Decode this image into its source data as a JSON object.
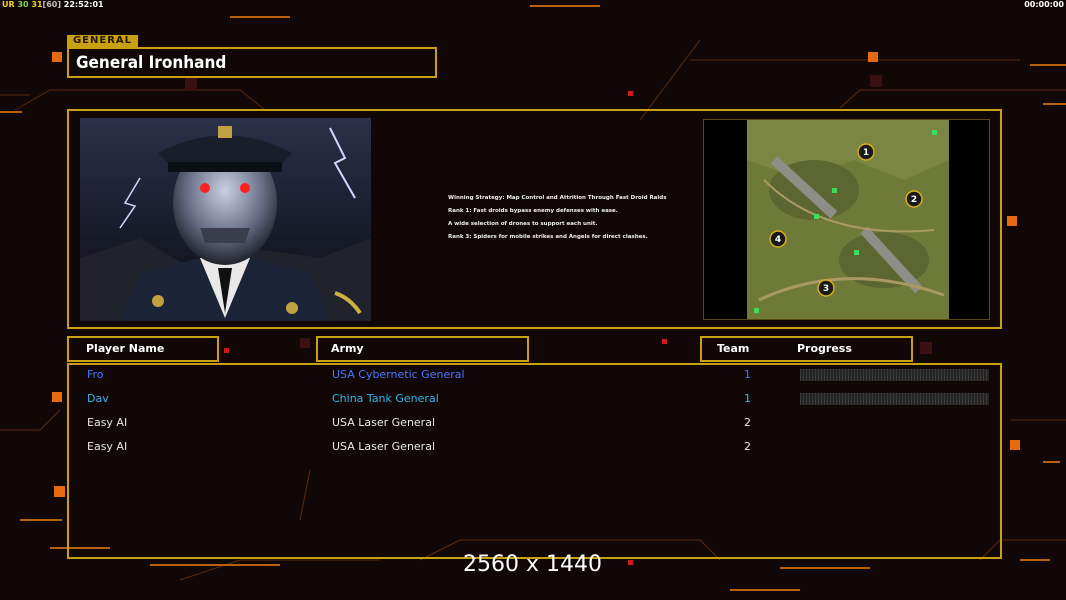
{
  "hud": {
    "ur_label": "UR",
    "fps": "30",
    "fps_alt": "31",
    "fps_cap": "[60]",
    "clock": "22:52:01",
    "timer": "00:00:00"
  },
  "colors": {
    "accent_gold": "#c9a012",
    "background": "#120707",
    "player_blue": "#4a76ff",
    "player_cyan": "#2fb6e6",
    "player_white": "#e8e8e8"
  },
  "general": {
    "tag": "GENERAL",
    "name": "General Ironhand",
    "portrait_icon": "cyborg-general-portrait",
    "map_icon": "skirmish-map-preview",
    "map_start_positions": [
      "1",
      "2",
      "3",
      "4"
    ]
  },
  "description": [
    "Winning Strategy: Map Control and Attrition Through Fast Droid Raids",
    "Rank 1: Fast droids bypass enemy defenses with ease.",
    "A wide selection of drones to support each unit.",
    "Rank 3: Spiders for mobile strikes and Angels for direct clashes."
  ],
  "columns": {
    "player_name": "Player Name",
    "army": "Army",
    "team": "Team",
    "progress": "Progress"
  },
  "players": [
    {
      "name": "Fro",
      "army": "USA Cybernetic General",
      "team": "1",
      "show_progress": true,
      "color": "#4a76ff",
      "progress": 0
    },
    {
      "name": "Dav",
      "army": "China Tank General",
      "team": "1",
      "show_progress": true,
      "color": "#2fb6e6",
      "progress": 0
    },
    {
      "name": "Easy AI",
      "army": "USA Laser General",
      "team": "2",
      "show_progress": false,
      "color": "#e8e8e8"
    },
    {
      "name": "Easy AI",
      "army": "USA Laser General",
      "team": "2",
      "show_progress": false,
      "color": "#e8e8e8"
    }
  ],
  "resolution_label": "2560 x 1440"
}
